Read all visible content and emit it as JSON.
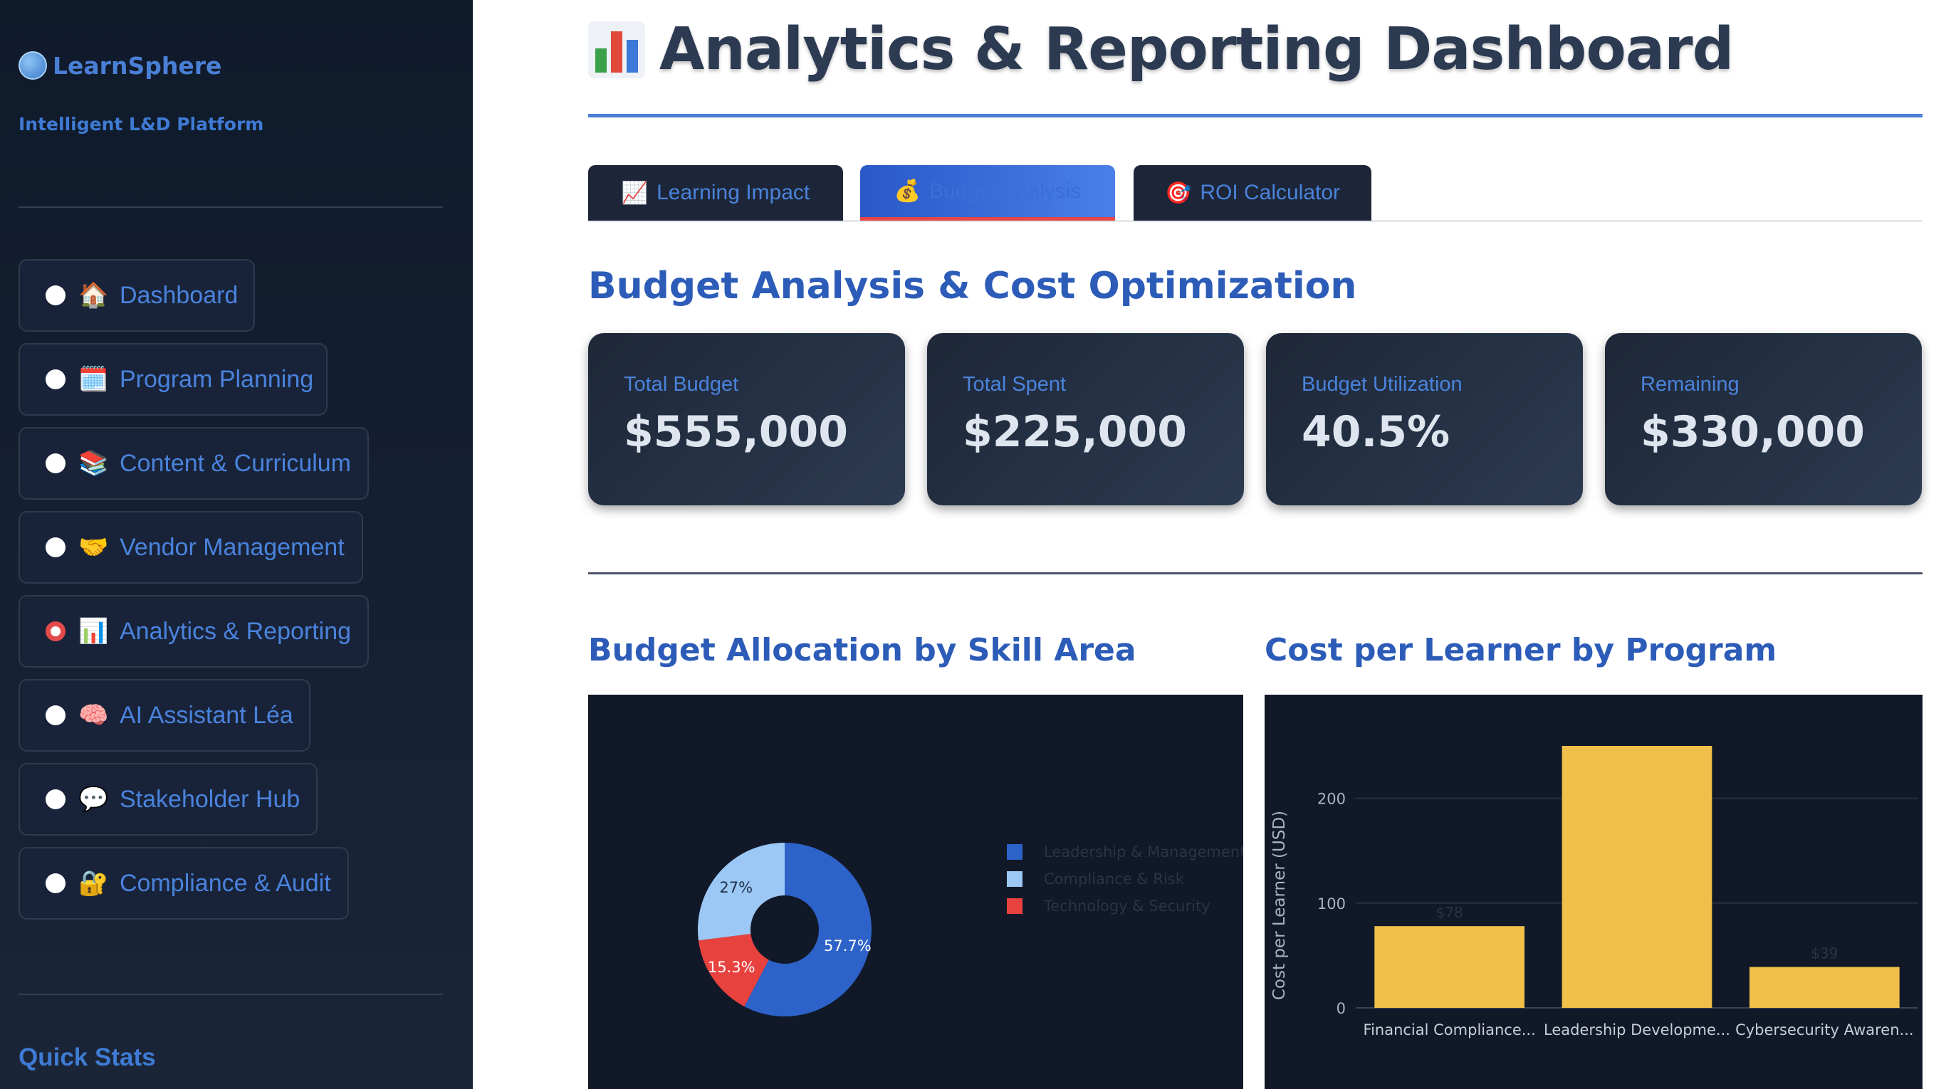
{
  "sidebar": {
    "brand": "LearnSphere",
    "tagline": "Intelligent L&D Platform",
    "items": [
      {
        "emoji": "🏠",
        "label": "Dashboard",
        "selected": false
      },
      {
        "emoji": "🗓️",
        "label": "Program Planning",
        "selected": false
      },
      {
        "emoji": "📚",
        "label": "Content & Curriculum",
        "selected": false
      },
      {
        "emoji": "🤝",
        "label": "Vendor Management",
        "selected": false
      },
      {
        "emoji": "📊",
        "label": "Analytics & Reporting",
        "selected": true
      },
      {
        "emoji": "🧠",
        "label": "AI Assistant Léa",
        "selected": false
      },
      {
        "emoji": "💬",
        "label": "Stakeholder Hub",
        "selected": false
      },
      {
        "emoji": "🔐",
        "label": "Compliance & Audit",
        "selected": false
      }
    ],
    "quick_stats_heading": "Quick Stats"
  },
  "header": {
    "title": "Analytics & Reporting Dashboard",
    "icon": "bar-chart-icon"
  },
  "tabs": [
    {
      "icon": "📈",
      "label": "Learning Impact",
      "active": false
    },
    {
      "icon": "💰",
      "label": "Budget Analysis",
      "active": true
    },
    {
      "icon": "🎯",
      "label": "ROI Calculator",
      "active": false
    }
  ],
  "section": {
    "heading": "Budget Analysis & Cost Optimization"
  },
  "metrics": [
    {
      "label": "Total Budget",
      "value": "$555,000"
    },
    {
      "label": "Total Spent",
      "value": "$225,000"
    },
    {
      "label": "Budget Utilization",
      "value": "40.5%"
    },
    {
      "label": "Remaining",
      "value": "$330,000"
    }
  ],
  "pie_heading": "Budget Allocation by Skill Area",
  "bar_heading": "Cost per Learner by Program",
  "colors": {
    "accent": "#4a7fd6",
    "heading": "#2c5cb8",
    "pie": [
      "#2d62c8",
      "#e8423f",
      "#9cc8f5"
    ],
    "bar": "#f0c04a"
  },
  "chart_data": [
    {
      "type": "pie",
      "title": "",
      "donut": true,
      "categories": [
        "Leadership & Management",
        "Technology & Security",
        "Compliance & Risk"
      ],
      "values": [
        57.7,
        15.3,
        27.0
      ],
      "value_labels": [
        "57.7%",
        "15.3%",
        "27%"
      ],
      "legend": [
        "Leadership & Management",
        "Compliance & Risk",
        "Technology & Security"
      ],
      "legend_position": "right"
    },
    {
      "type": "bar",
      "title": "",
      "categories": [
        "Financial Compliance...",
        "Leadership Developme...",
        "Cybersecurity Awaren..."
      ],
      "values": [
        78,
        250,
        39
      ],
      "data_labels": [
        "$78",
        "",
        "$39"
      ],
      "xlabel": "",
      "ylabel": "Cost per Learner (USD)",
      "yticks": [
        0,
        100,
        200
      ],
      "ylim": [
        0,
        250
      ],
      "grid": true
    }
  ]
}
